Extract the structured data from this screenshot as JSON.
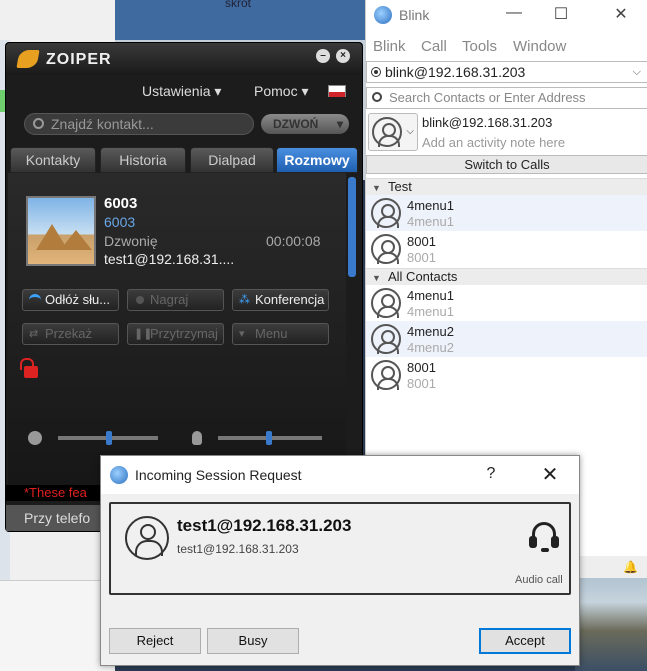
{
  "desktop": {
    "top_label": "skrót"
  },
  "zoiper": {
    "brand": "ZOIPER",
    "menu": {
      "settings": "Ustawienia ▾",
      "help": "Pomoc ▾"
    },
    "search_placeholder": "Znajdź kontakt...",
    "call_button": "DZWOŃ",
    "tabs": [
      "Kontakty",
      "Historia",
      "Dialpad",
      "Rozmowy"
    ],
    "active_tab": "Rozmowy",
    "call": {
      "name": "6003",
      "number": "6003",
      "status": "Dzwonię",
      "timer": "00:00:08",
      "address": "test1@192.168.31...."
    },
    "buttons": {
      "hangup": "Odłóż słu...",
      "record": "Nagraj",
      "conference": "Konferencja",
      "transfer": "Przekaż",
      "hold": "Przytrzymaj",
      "menu": "Menu"
    },
    "warning": "*These fea",
    "footer": "Przy telefo"
  },
  "blink": {
    "title": "Blink",
    "menu": [
      "Blink",
      "Call",
      "Tools",
      "Window"
    ],
    "account": "blink@192.168.31.203",
    "search_placeholder": "Search Contacts or Enter Address",
    "me": {
      "name": "blink@192.168.31.203",
      "note_placeholder": "Add an activity note here"
    },
    "switch_button": "Switch to Calls",
    "groups": [
      {
        "name": "Test",
        "contacts": [
          {
            "name": "4menu1",
            "uri": "4menu1"
          },
          {
            "name": "8001",
            "uri": "8001"
          }
        ]
      },
      {
        "name": "All Contacts",
        "contacts": [
          {
            "name": "4menu1",
            "uri": "4menu1"
          },
          {
            "name": "4menu2",
            "uri": "4menu2"
          },
          {
            "name": "8001",
            "uri": "8001"
          }
        ]
      }
    ]
  },
  "dialog": {
    "title": "Incoming Session Request",
    "help": "?",
    "close": "✕",
    "caller": "test1@192.168.31.203",
    "caller_uri": "test1@192.168.31.203",
    "call_type": "Audio call",
    "buttons": {
      "reject": "Reject",
      "busy": "Busy",
      "accept": "Accept"
    }
  }
}
